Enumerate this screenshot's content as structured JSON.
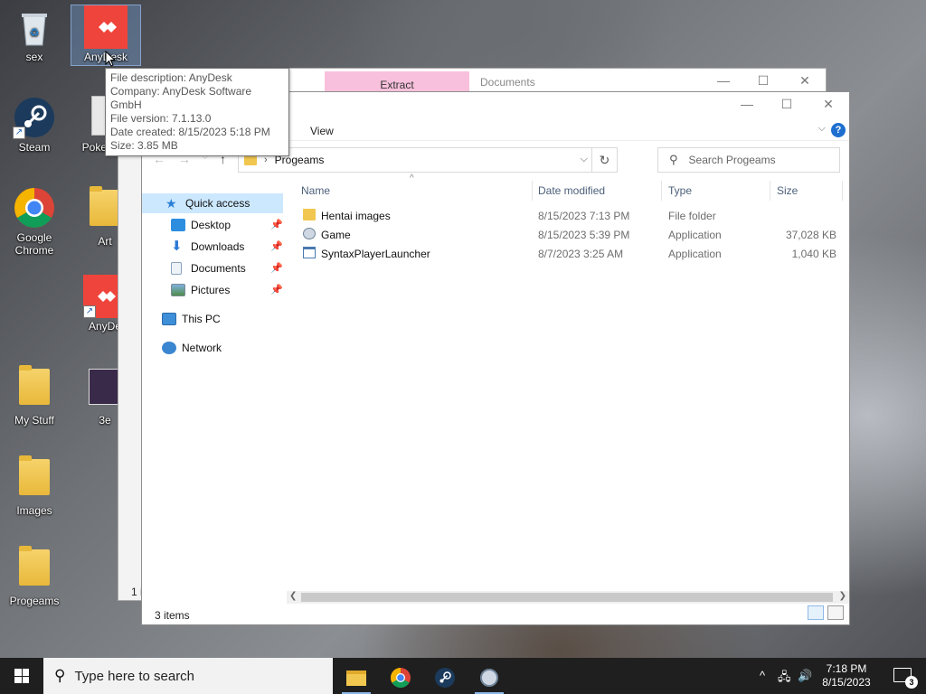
{
  "desktop": {
    "icons": [
      {
        "label": "sex"
      },
      {
        "label": "AnyDesk"
      },
      {
        "label": "Steam"
      },
      {
        "label": "Pokemon"
      },
      {
        "label": "Google Chrome"
      },
      {
        "label": "Art"
      },
      {
        "label": "AnyDe"
      },
      {
        "label": "My Stuff"
      },
      {
        "label": "3e"
      },
      {
        "label": "Images"
      },
      {
        "label": "Progeams"
      }
    ]
  },
  "tooltip": {
    "lines": [
      "File description: AnyDesk",
      "Company: AnyDesk Software GmbH",
      "File version: 7.1.13.0",
      "Date created: 8/15/2023 5:18 PM",
      "Size: 3.85 MB"
    ]
  },
  "back_window": {
    "extract_tab": "Extract",
    "title": "Documents",
    "status_fragment": "1 i"
  },
  "explorer": {
    "view_tab": "View",
    "help": "?",
    "address_path": "Progeams",
    "search_placeholder": "Search Progeams",
    "nav": {
      "quick_access": "Quick access",
      "desktop": "Desktop",
      "downloads": "Downloads",
      "documents": "Documents",
      "pictures": "Pictures",
      "this_pc": "This PC",
      "network": "Network"
    },
    "columns": {
      "name": "Name",
      "date": "Date modified",
      "type": "Type",
      "size": "Size"
    },
    "files": [
      {
        "name": "Hentai images",
        "date": "8/15/2023 7:13 PM",
        "type": "File folder",
        "size": ""
      },
      {
        "name": "Game",
        "date": "8/15/2023 5:39 PM",
        "type": "Application",
        "size": "37,028 KB"
      },
      {
        "name": "SyntaxPlayerLauncher",
        "date": "8/7/2023 3:25 AM",
        "type": "Application",
        "size": "1,040 KB"
      }
    ],
    "status": "3 items"
  },
  "taskbar": {
    "search_placeholder": "Type here to search",
    "time": "7:18 PM",
    "date": "8/15/2023",
    "notification_count": "3"
  },
  "colors": {
    "anydesk": "#ef443b",
    "selection": "#cce8ff",
    "taskbar": "#1f1f1f"
  }
}
